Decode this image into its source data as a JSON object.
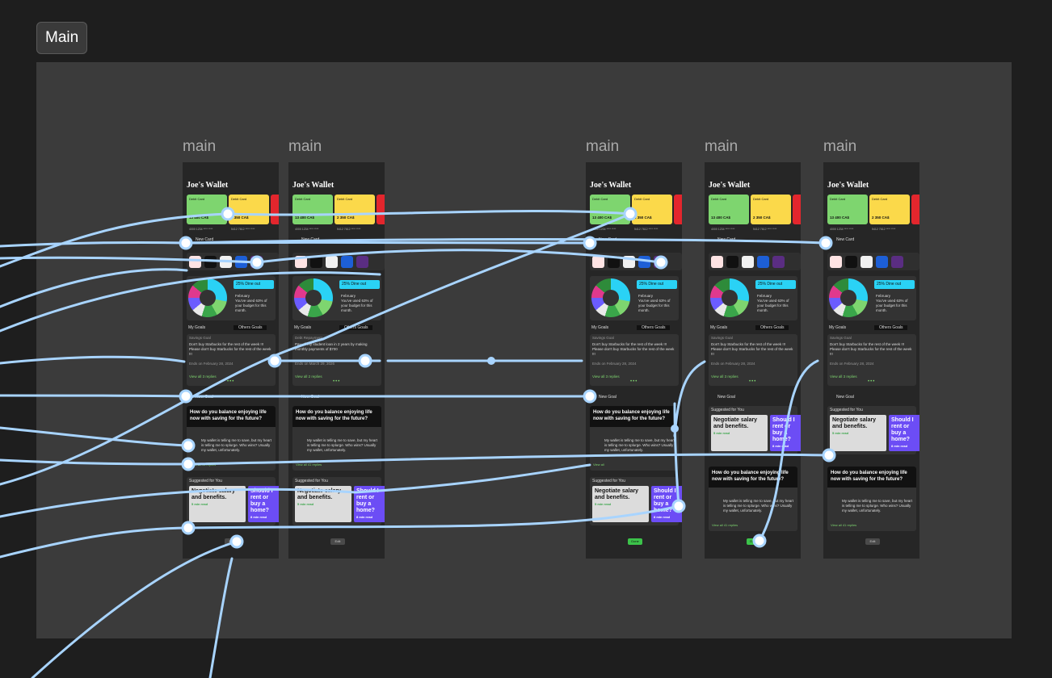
{
  "page_tab": "Main",
  "frames": [
    {
      "label": "main",
      "title": "Joe's Wallet",
      "card1_type": "Debit Card",
      "card1_balance": "13 400 CA$",
      "card1_num": "4000 1234 **** ****",
      "card2_type": "Debit Card",
      "card2_balance": "2 350 CA$",
      "card2_num": "5412 7612 **** ****",
      "new_card": "New Card",
      "budget_pct": "25%",
      "budget_cat": "Dine out",
      "budget_month": "February",
      "budget_text": "You've used 63% of your budget for this month.",
      "tab_mine": "My Goals",
      "tab_others": "Others Goals",
      "goal_kind": "Savings Goal",
      "goal_text": "Don't buy Starbucks for the rest of the week !!! Please don't buy Starbucks for the rest of the week !!!",
      "goal_date": "Ends on February 28, 2024",
      "view_replies": "View all 3 replies",
      "new_goal": "New Goal",
      "question": "How do you balance enjoying life now with saving for the future?",
      "answer": "My wallet is telling me to save, but my heart is telling me to splurge. Who wins? Usually my wallet, unfortunately.",
      "answer_replies": "View all 41 replies",
      "suggested": "Suggested for You",
      "sug1": "Negotiate salary and benefits.",
      "sug1_read": "5 min read",
      "sug2": "Should I rent or buy a home?",
      "sug2_read": "8 min read",
      "btn": "Edit"
    },
    {
      "label": "main",
      "title": "Joe's Wallet",
      "card1_type": "Debit Card",
      "card1_balance": "13 400 CA$",
      "card1_num": "4000 1234 **** ****",
      "card2_type": "Debit Card",
      "card2_balance": "2 350 CA$",
      "card2_num": "5412 7612 **** ****",
      "new_card": "New Card",
      "budget_pct": "25%",
      "budget_cat": "Dine out",
      "budget_month": "February",
      "budget_text": "You've used 63% of your budget for this month.",
      "tab_mine": "My Goals",
      "tab_others": "Others Goals",
      "goal_kind": "Debt Repayment",
      "goal_text": "Pay off my student loan in 2 years by making monthly payments of $700",
      "goal_date": "Ends on March 29, 2026",
      "view_replies": "View all 2 replies",
      "new_goal": "New Goal",
      "question": "How do you balance enjoying life now with saving for the future?",
      "answer": "My wallet is telling me to save, but my heart is telling me to splurge. Who wins? Usually my wallet, unfortunately.",
      "answer_replies": "View all 41 replies",
      "suggested": "Suggested for You",
      "sug1": "Negotiate salary and benefits.",
      "sug1_read": "5 min read",
      "sug2": "Should I rent or buy a home?",
      "sug2_read": "8 min read",
      "btn": "Edit"
    },
    {
      "label": "main",
      "title": "Joe's Wallet",
      "card1_type": "Debit Card",
      "card1_balance": "13 400 CA$",
      "card1_num": "4000 1234 **** ****",
      "card2_type": "Debit Card",
      "card2_balance": "2 350 CA$",
      "card2_num": "5412 7612 **** ****",
      "new_card": "New Card",
      "budget_pct": "25%",
      "budget_cat": "Dine out",
      "budget_month": "February",
      "budget_text": "You've used 63% of your budget for this month.",
      "tab_mine": "My Goals",
      "tab_others": "Others Goals",
      "goal_kind": "Savings Goal",
      "goal_text": "Don't buy Starbucks for the rest of the week !!! Please don't buy Starbucks for the rest of the week !!!",
      "goal_date": "Ends on February 28, 2024",
      "view_replies": "View all 3 replies",
      "new_goal": "New Goal",
      "question": "How do you balance enjoying life now with saving for the future?",
      "answer": "My wallet is telling me to save, but my heart is telling me to splurge. Who wins? Usually my wallet, unfortunately.",
      "answer_replies": "View all",
      "suggested": "Suggested for You",
      "sug1": "Negotiate salary and benefits.",
      "sug1_read": "5 min read",
      "sug2": "Should I rent or buy a home?",
      "sug2_read": "8 min read",
      "btn": "Done"
    },
    {
      "label": "main",
      "title": "Joe's Wallet",
      "card1_type": "Debit Card",
      "card1_balance": "13 400 CA$",
      "card1_num": "4000 1234 **** ****",
      "card2_type": "Debit Card",
      "card2_balance": "2 350 CA$",
      "card2_num": "5412 7612 **** ****",
      "new_card": "New Card",
      "budget_pct": "25%",
      "budget_cat": "Dine out",
      "budget_month": "February",
      "budget_text": "You've used 63% of your budget for this month.",
      "tab_mine": "My Goals",
      "tab_others": "Others Goals",
      "goal_kind": "Savings Goal",
      "goal_text": "Don't buy Starbucks for the rest of the week !!! Please don't buy Starbucks for the rest of the week !!!",
      "goal_date": "Ends on February 28, 2024",
      "view_replies": "View all 3 replies",
      "new_goal": "New Goal",
      "question": "How do you balance enjoying life now with saving for the future?",
      "answer": "My wallet is telling me to save, but my heart is telling me to splurge. Who wins? Usually my wallet, unfortunately.",
      "answer_replies": "View all 41 replies",
      "suggested": "Suggested for You",
      "sug1": "Negotiate salary and benefits.",
      "sug1_read": "5 min read",
      "sug2": "Should I rent or buy a home?",
      "sug2_read": "8 min read",
      "btn": "Done"
    },
    {
      "label": "main",
      "title": "Joe's Wallet",
      "card1_type": "Debit Card",
      "card1_balance": "13 400 CA$",
      "card1_num": "4000 1234 **** ****",
      "card2_type": "Debit Card",
      "card2_balance": "2 350 CA$",
      "card2_num": "5412 7612 **** ****",
      "new_card": "New Card",
      "budget_pct": "25%",
      "budget_cat": "Dine out",
      "budget_month": "February",
      "budget_text": "You've used 63% of your budget for this month.",
      "tab_mine": "My Goals",
      "tab_others": "Others Goals",
      "goal_kind": "Savings Goal",
      "goal_text": "Don't buy Starbucks for the rest of the week !!! Please don't buy Starbucks for the rest of the week !!!",
      "goal_date": "Ends on February 28, 2024",
      "view_replies": "View all 3 replies",
      "new_goal": "New Goal",
      "question": "How do you balance enjoying life now with saving for the future?",
      "answer": "My wallet is telling me to save, but my heart is telling me to splurge. Who wins? Usually my wallet, unfortunately.",
      "answer_replies": "View all 41 replies",
      "suggested": "Suggested for You",
      "sug1": "Negotiate salary and benefits.",
      "sug1_read": "5 min read",
      "sug2": "Should I rent or buy a home?",
      "sug2_read": "8 min read",
      "btn": "Edit"
    }
  ],
  "colors": {
    "link": "#a8d4ff",
    "canvas": "#3b3b3b",
    "frame": "#262626",
    "accent_green": "#7ed56f",
    "accent_cyan": "#2ad2f5",
    "accent_purple": "#6c4df5"
  }
}
